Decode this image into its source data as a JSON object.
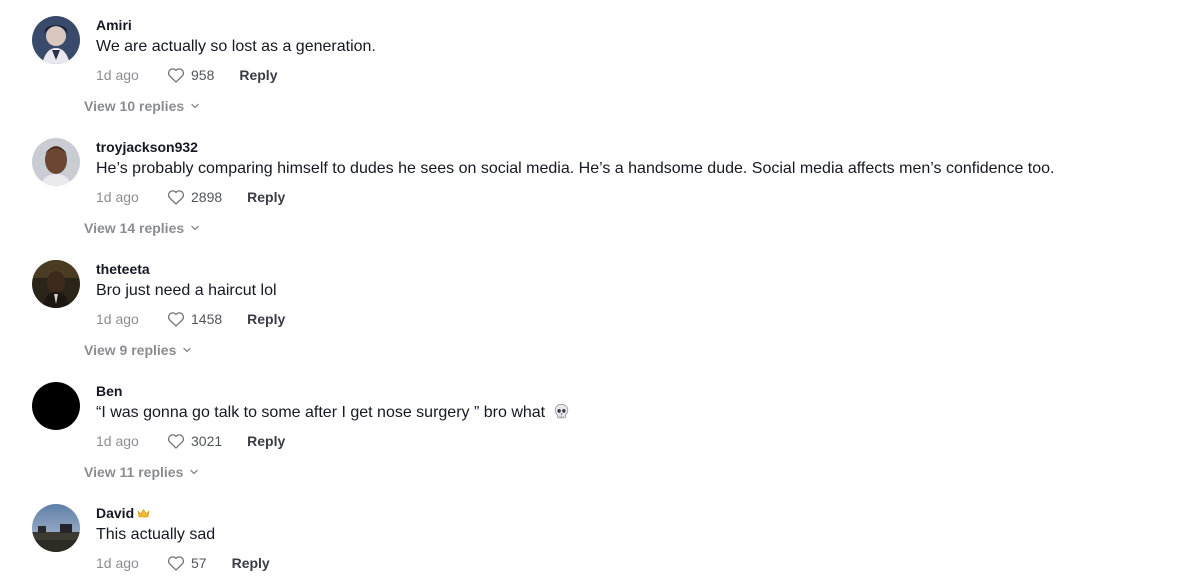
{
  "comments": [
    {
      "username": "Amiri",
      "text": "We are actually so lost as a generation.",
      "time": "1d ago",
      "likes": "958",
      "reply_label": "Reply",
      "view_replies": "View 10 replies",
      "avatar": "anime-character-avatar"
    },
    {
      "username": "troyjackson932",
      "text": "He’s probably comparing himself to dudes he sees on social media. He’s a handsome dude. Social media affects men’s confidence too.",
      "time": "1d ago",
      "likes": "2898",
      "reply_label": "Reply",
      "view_replies": "View 14 replies",
      "avatar": "person-photo-avatar"
    },
    {
      "username": "theteeta",
      "text": "Bro just need a haircut lol",
      "time": "1d ago",
      "likes": "1458",
      "reply_label": "Reply",
      "view_replies": "View 9 replies",
      "avatar": "person-dark-photo-avatar"
    },
    {
      "username": "Ben",
      "text": "“I was gonna go talk to some after I get nose surgery ” bro what",
      "emoji": "skull-icon",
      "time": "1d ago",
      "likes": "3021",
      "reply_label": "Reply",
      "view_replies": "View 11 replies",
      "avatar": "black-avatar"
    },
    {
      "username": "David",
      "badge": "crown-icon",
      "text": "This actually sad",
      "time": "1d ago",
      "likes": "57",
      "reply_label": "Reply",
      "avatar": "landscape-photo-avatar"
    }
  ]
}
